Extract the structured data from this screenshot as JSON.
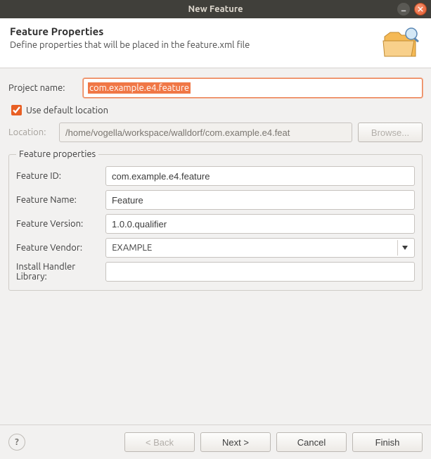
{
  "window": {
    "title": "New Feature"
  },
  "header": {
    "title": "Feature Properties",
    "desc": "Define properties that will be placed in the feature.xml file"
  },
  "project_label": "Project name:",
  "project_value": "com.example.e4.feature",
  "use_default_label": "Use default location",
  "location_label": "Location:",
  "location_value": "/home/vogella/workspace/walldorf/com.example.e4.feat",
  "browse_label": "Browse...",
  "legend": "Feature properties",
  "fields": {
    "id_label": "Feature ID:",
    "id_value": "com.example.e4.feature",
    "name_label": "Feature Name:",
    "name_value": "Feature",
    "version_label": "Feature Version:",
    "version_value": "1.0.0.qualifier",
    "vendor_label": "Feature Vendor:",
    "vendor_value": "EXAMPLE",
    "handler_label": "Install Handler Library:",
    "handler_value": ""
  },
  "buttons": {
    "back": "< Back",
    "next": "Next >",
    "cancel": "Cancel",
    "finish": "Finish"
  }
}
